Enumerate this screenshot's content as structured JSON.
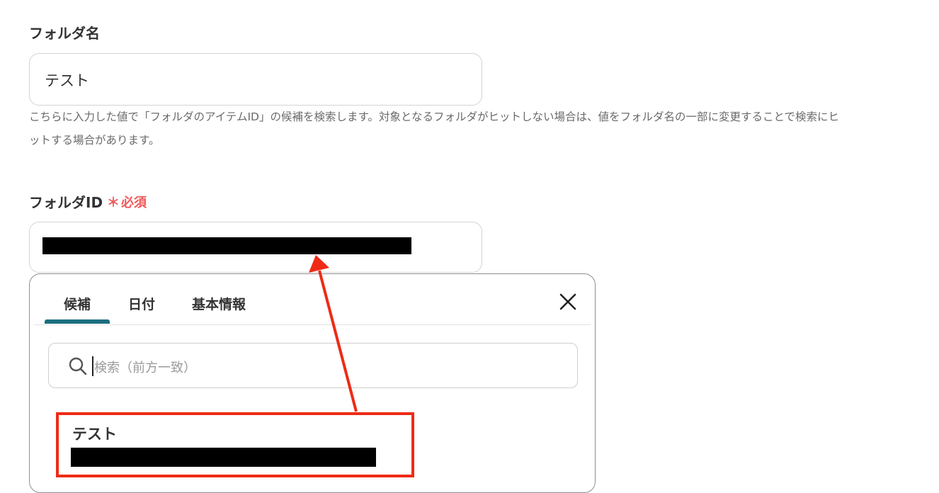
{
  "folder_name": {
    "label": "フォルダ名",
    "value": "テスト",
    "help_line1": "こちらに入力した値で「フォルダのアイテムID」の候補を検索します。対象となるフォルダがヒットしない場合は、値をフォルダ名の一部に変更することで検索にヒ",
    "help_line2": "ットする場合があります。"
  },
  "folder_id": {
    "label": "フォルダID",
    "required_mark": "＊",
    "required_text": "必須"
  },
  "picker": {
    "tabs": [
      "候補",
      "日付",
      "基本情報"
    ],
    "active_tab": "候補",
    "search_placeholder": "検索（前方一致）",
    "candidates": [
      {
        "title": "テスト"
      }
    ]
  },
  "colors": {
    "accent_tab_underline": "#1b6f80",
    "required": "#f25a5a",
    "annotation_red": "#ee2b16"
  }
}
